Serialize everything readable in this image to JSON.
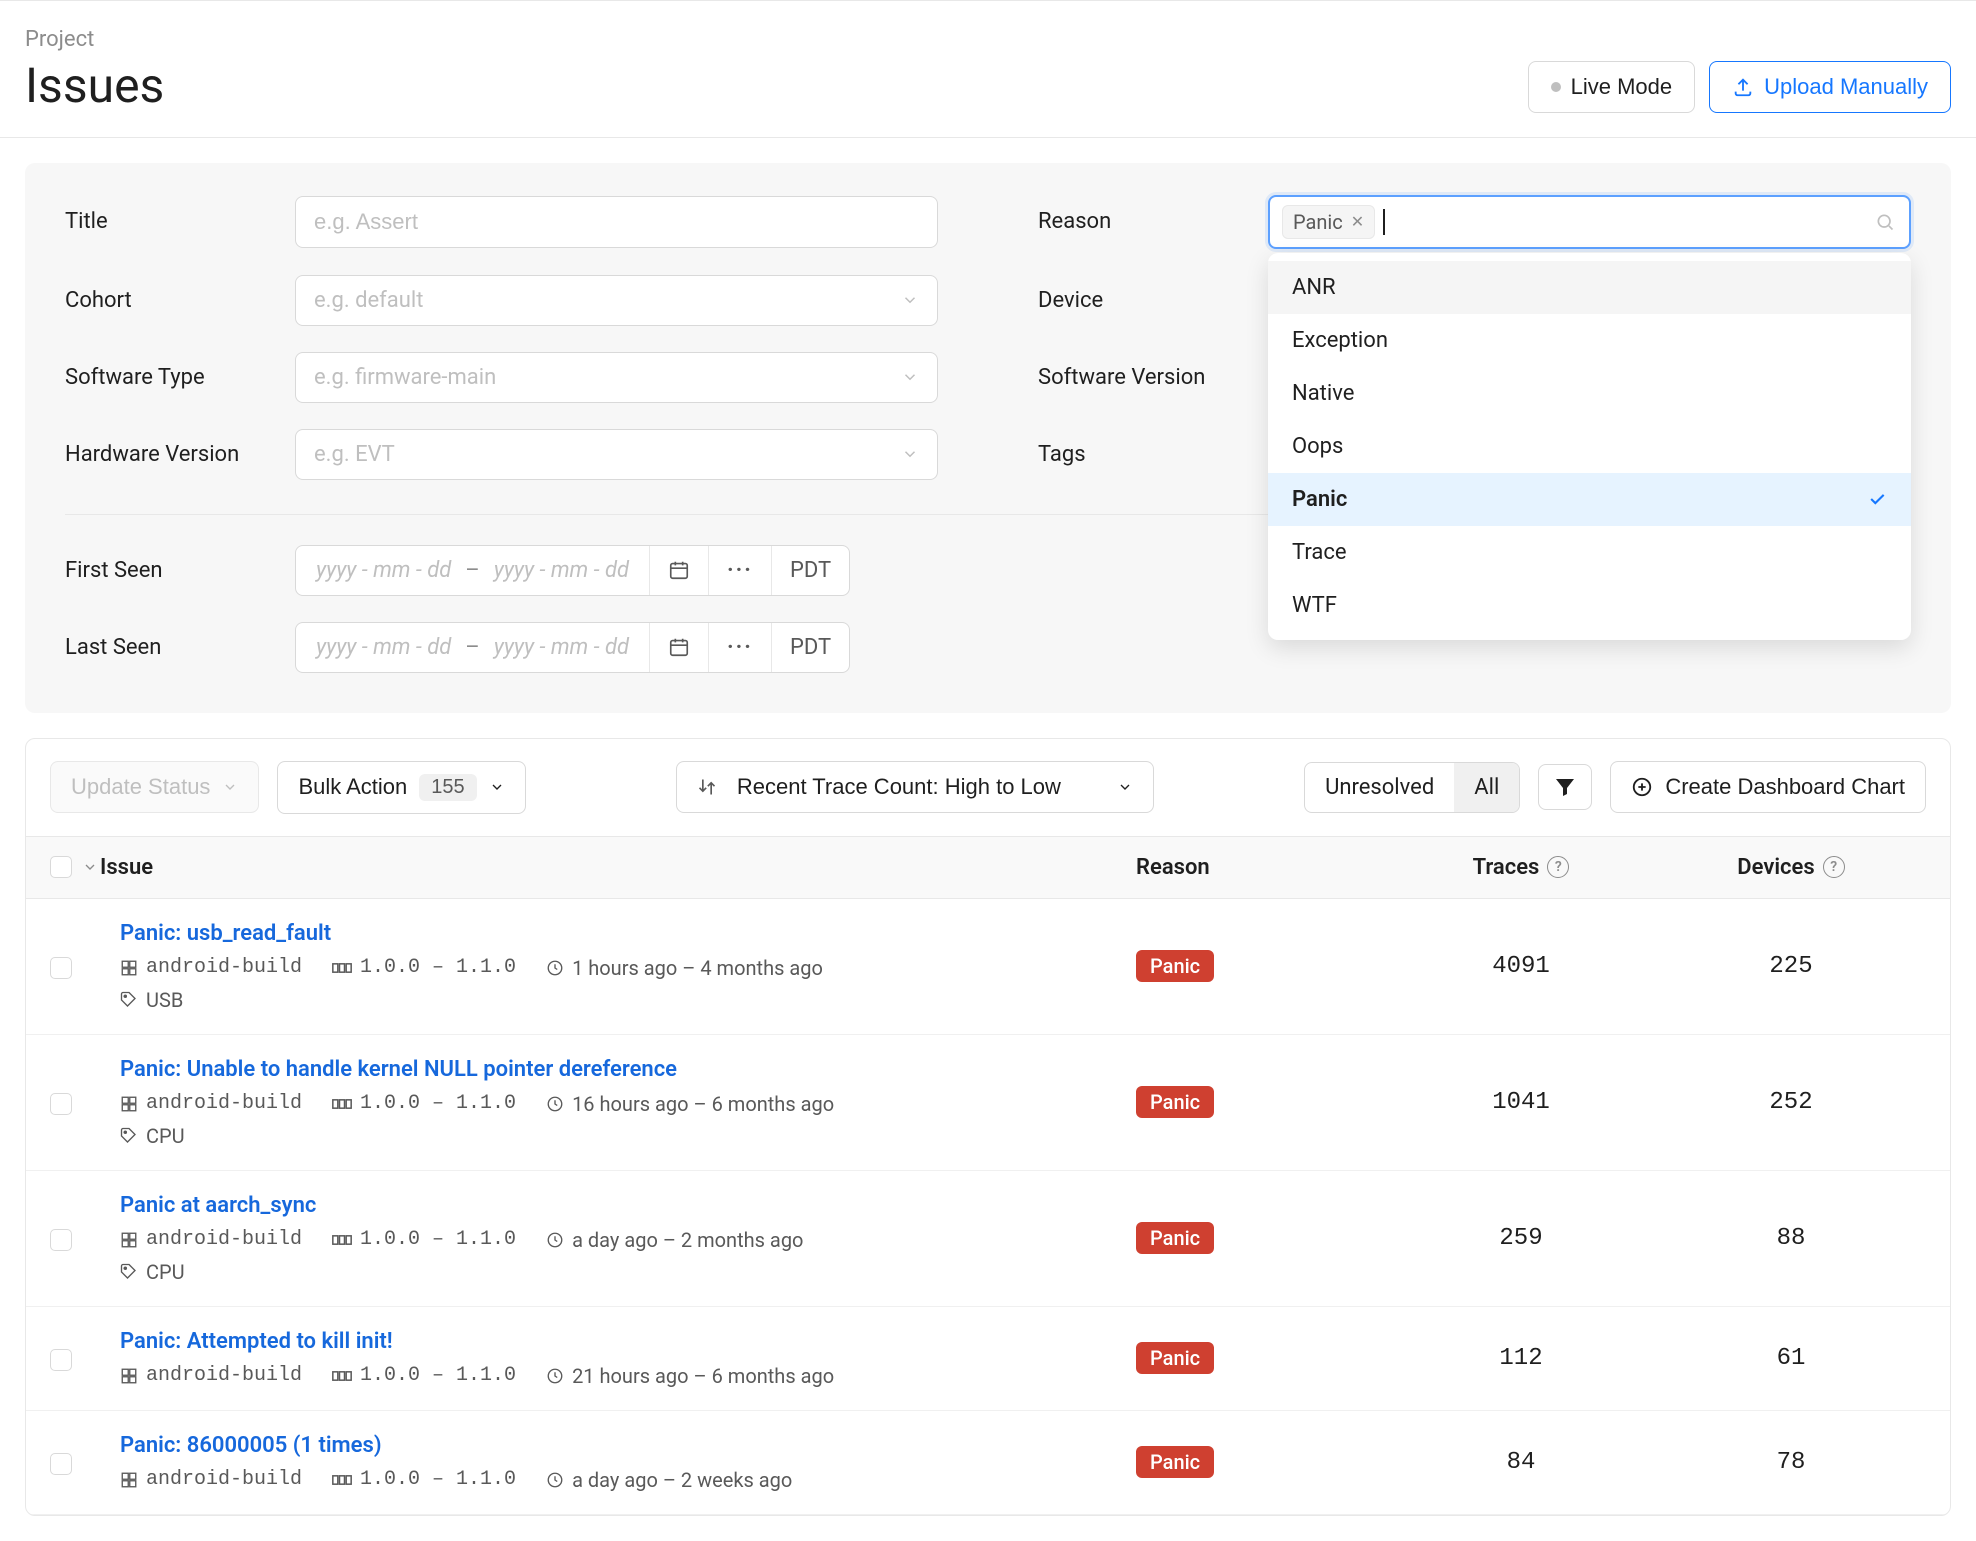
{
  "breadcrumb": "Project",
  "page_title": "Issues",
  "header": {
    "live_mode": "Live Mode",
    "upload": "Upload Manually"
  },
  "filters": {
    "title_label": "Title",
    "title_placeholder": "e.g. Assert",
    "cohort_label": "Cohort",
    "cohort_placeholder": "e.g. default",
    "swtype_label": "Software Type",
    "swtype_placeholder": "e.g. firmware-main",
    "hwver_label": "Hardware Version",
    "hwver_placeholder": "e.g. EVT",
    "reason_label": "Reason",
    "reason_tag": "Panic",
    "device_label": "Device",
    "swver_label": "Software Version",
    "tags_label": "Tags",
    "first_seen_label": "First Seen",
    "last_seen_label": "Last Seen",
    "date_placeholder_from": "yyyy - mm - dd",
    "date_placeholder_to": "yyyy - mm - dd",
    "tz": "PDT"
  },
  "reason_dropdown": {
    "items": [
      "ANR",
      "Exception",
      "Native",
      "Oops",
      "Panic",
      "Trace",
      "WTF"
    ],
    "highlighted": "ANR",
    "selected": "Panic"
  },
  "toolbar": {
    "update_status": "Update Status",
    "bulk_action": "Bulk Action",
    "bulk_count": "155",
    "sort_label": "Recent Trace Count: High to Low",
    "seg_unresolved": "Unresolved",
    "seg_all": "All",
    "create_chart": "Create Dashboard Chart"
  },
  "columns": {
    "issue": "Issue",
    "reason": "Reason",
    "traces": "Traces",
    "devices": "Devices"
  },
  "rows": [
    {
      "title": "Panic: usb_read_fault",
      "build": "android-build",
      "ver": "1.0.0 – 1.1.0",
      "time": "1 hours ago – 4 months ago",
      "tag": "USB",
      "reason": "Panic",
      "traces": "4091",
      "devices": "225"
    },
    {
      "title": "Panic: Unable to handle kernel NULL pointer dereference",
      "build": "android-build",
      "ver": "1.0.0 – 1.1.0",
      "time": "16 hours ago – 6 months ago",
      "tag": "CPU",
      "reason": "Panic",
      "traces": "1041",
      "devices": "252"
    },
    {
      "title": "Panic at aarch_sync",
      "build": "android-build",
      "ver": "1.0.0 – 1.1.0",
      "time": "a day ago – 2 months ago",
      "tag": "CPU",
      "reason": "Panic",
      "traces": "259",
      "devices": "88"
    },
    {
      "title": "Panic: Attempted to kill init!",
      "build": "android-build",
      "ver": "1.0.0 – 1.1.0",
      "time": "21 hours ago – 6 months ago",
      "tag": "",
      "reason": "Panic",
      "traces": "112",
      "devices": "61"
    },
    {
      "title": "Panic: 86000005 (1 times)",
      "build": "android-build",
      "ver": "1.0.0 – 1.1.0",
      "time": "a day ago – 2 weeks ago",
      "tag": "",
      "reason": "Panic",
      "traces": "84",
      "devices": "78"
    }
  ]
}
